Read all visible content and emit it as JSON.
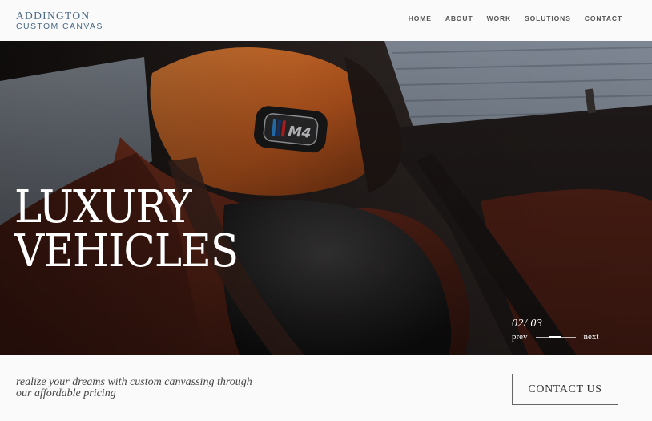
{
  "brand": {
    "line1": "ADDINGTON",
    "line2": "CUSTOM CANVAS"
  },
  "nav": {
    "items": [
      "HOME",
      "ABOUT",
      "WORK",
      "SOLUTIONS",
      "CONTACT"
    ]
  },
  "hero": {
    "title_line1": "LUXURY",
    "title_line2": "VEHICLES",
    "badge_text": "M4"
  },
  "slider": {
    "counter": "02/ 03",
    "prev_label": "prev",
    "next_label": "next",
    "progress": 0.67
  },
  "footer": {
    "tagline": "realize your dreams with custom canvassing through our affordable pricing",
    "cta_label": "CONTACT US"
  },
  "colors": {
    "brand": "#4b6a86",
    "nav_text": "#555555",
    "hero_text": "#ffffff",
    "background": "#fafafa"
  }
}
